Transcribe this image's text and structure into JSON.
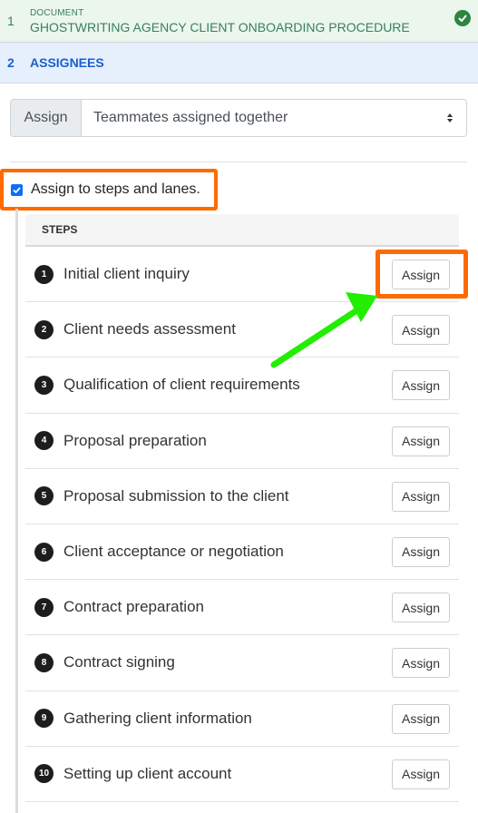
{
  "wizard": {
    "step1": {
      "number": "1",
      "kicker": "DOCUMENT",
      "title": "GHOSTWRITING AGENCY CLIENT ONBOARDING PROCEDURE",
      "status_icon": "check-circle-icon"
    },
    "step2": {
      "number": "2",
      "title": "ASSIGNEES"
    }
  },
  "assign": {
    "label": "Assign",
    "selected": "Teammates assigned together"
  },
  "checkbox": {
    "label": "Assign to steps and lanes.",
    "checked": true
  },
  "steps": {
    "header": "STEPS",
    "button_label": "Assign",
    "items": [
      {
        "number": "1",
        "name": "Initial client inquiry"
      },
      {
        "number": "2",
        "name": "Client needs assessment"
      },
      {
        "number": "3",
        "name": "Qualification of client requirements"
      },
      {
        "number": "4",
        "name": "Proposal preparation"
      },
      {
        "number": "5",
        "name": "Proposal submission to the client"
      },
      {
        "number": "6",
        "name": "Client acceptance or negotiation"
      },
      {
        "number": "7",
        "name": "Contract preparation"
      },
      {
        "number": "8",
        "name": "Contract signing"
      },
      {
        "number": "9",
        "name": "Gathering client information"
      },
      {
        "number": "10",
        "name": "Setting up client account"
      }
    ]
  },
  "colors": {
    "highlight": "#ff6a00",
    "arrow": "#22ee00",
    "active_step": "#1a5fd0",
    "done_step": "#3a7d64"
  }
}
